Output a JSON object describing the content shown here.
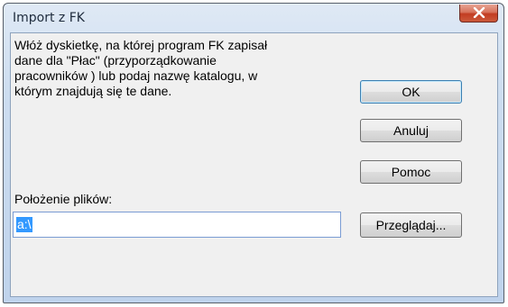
{
  "window": {
    "title": "Import z FK",
    "close_label": "Zamknij"
  },
  "message": "Włóż dyskietkę, na której program FK zapisał\ndane dla \"Płac\" (przyporządkowanie\npracowników ) lub podaj nazwę katalogu, w\nktórym znajdują się te dane.",
  "buttons": {
    "ok": "OK",
    "cancel": "Anuluj",
    "help": "Pomoc",
    "browse": "Przeglądaj..."
  },
  "path_field": {
    "label": "Położenie plików:",
    "value": "a:\\"
  },
  "colors": {
    "selection": "#3399ff",
    "close_button": "#c23c22",
    "frame": "#bfd3ec"
  }
}
